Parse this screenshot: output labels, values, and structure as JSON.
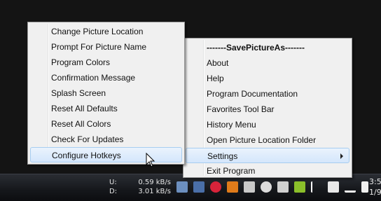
{
  "main_menu": {
    "header": "-------SavePictureAs-------",
    "items": [
      {
        "label": "About"
      },
      {
        "label": "Help"
      },
      {
        "label": "Program Documentation"
      },
      {
        "label": "Favorites Tool Bar"
      },
      {
        "label": "History Menu"
      },
      {
        "label": "Open Picture Location Folder"
      },
      {
        "label": "Settings"
      },
      {
        "label": "Exit Program"
      }
    ]
  },
  "settings_submenu": {
    "items": [
      {
        "label": "Change Picture Location"
      },
      {
        "label": "Prompt For Picture Name"
      },
      {
        "label": "Program Colors"
      },
      {
        "label": "Confirmation Message"
      },
      {
        "label": "Splash Screen"
      },
      {
        "label": "Reset All Defaults"
      },
      {
        "label": "Reset All Colors"
      },
      {
        "label": "Check For Updates"
      },
      {
        "label": "Configure Hotkeys"
      }
    ]
  },
  "network_meter": {
    "upload_label": "U:",
    "upload_value": "0.59 kB/s",
    "download_label": "D:",
    "download_value": "3.01 kB/s"
  },
  "clock": {
    "time": "3:5",
    "date": "1/9"
  },
  "tray_icons": [
    {
      "name": "image-icon",
      "color": "#6c8fbf"
    },
    {
      "name": "monitor-icon",
      "color": "#4a6fa8"
    },
    {
      "name": "red-circle-icon",
      "color": "#d8233a"
    },
    {
      "name": "flame-icon",
      "color": "#e07b1a"
    },
    {
      "name": "shield-icon",
      "color": "#c9c9c9"
    },
    {
      "name": "chat-bubble-icon",
      "color": "#dcdcdc"
    },
    {
      "name": "camera-icon",
      "color": "#d0d0d0"
    },
    {
      "name": "green-box-icon",
      "color": "#8bbf2a"
    },
    {
      "name": "flag-icon",
      "color": "#ffffff"
    },
    {
      "name": "plug-icon",
      "color": "#e8e8e8"
    },
    {
      "name": "signal-icon",
      "color": "#f0f0f0"
    },
    {
      "name": "speaker-icon",
      "color": "#f0f0f0"
    }
  ],
  "colors": {
    "menu_bg": "#f0f0f0",
    "highlight_bg": "#d4e6fb",
    "highlight_border": "#a7cdf0",
    "taskbar": "#15171b"
  }
}
